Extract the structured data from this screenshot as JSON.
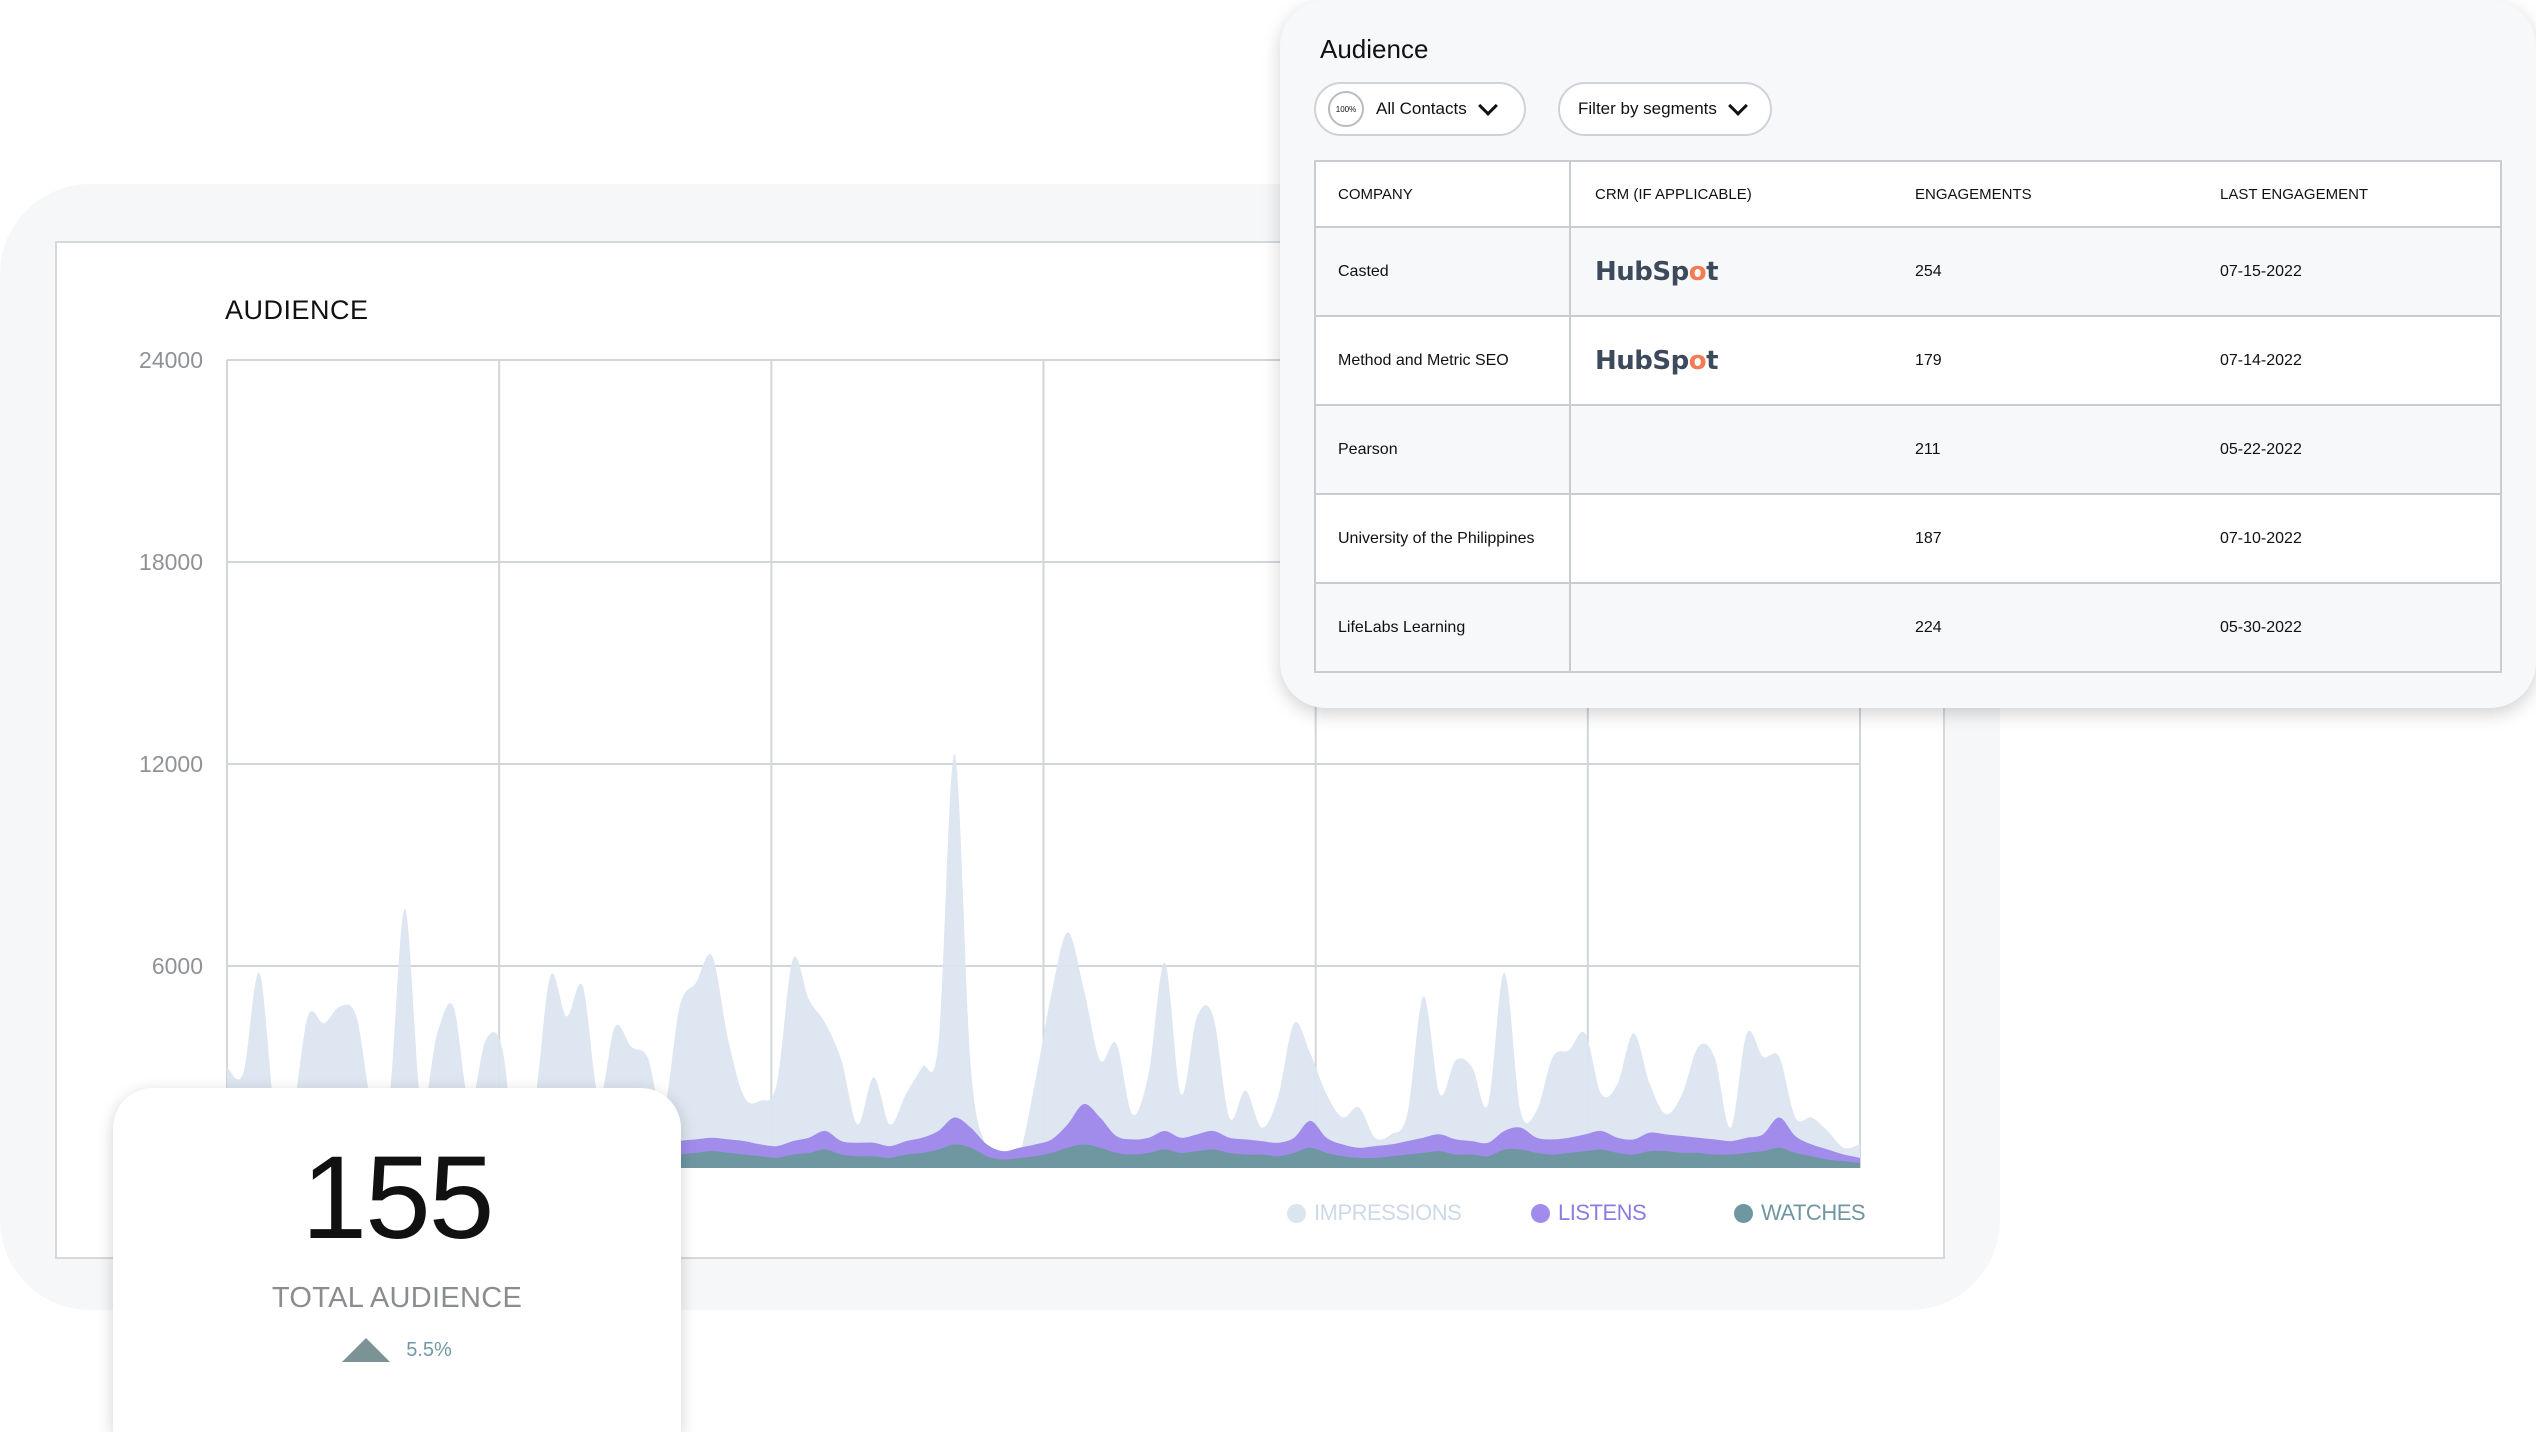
{
  "chart_card": {
    "title": "AUDIENCE",
    "legend": [
      {
        "label": "IMPRESSIONS",
        "color": "#dbe5f0",
        "text_color": "#cdd9e7"
      },
      {
        "label": "LISTENS",
        "color": "#a18ceb",
        "text_color": "#8d7be4"
      },
      {
        "label": "WATCHES",
        "color": "#6f97a2",
        "text_color": "#6f97a2"
      }
    ]
  },
  "chart_data": {
    "type": "area",
    "title": "AUDIENCE",
    "ylim": [
      0,
      24000
    ],
    "yticks": [
      "24000",
      "18000",
      "12000",
      "6000"
    ],
    "grid": true,
    "legend_position": "bottom-right",
    "series": [
      {
        "name": "IMPRESSIONS",
        "color": "#dbe5f0",
        "values": [
          3000,
          2800,
          5800,
          1500,
          1500,
          4500,
          4300,
          4800,
          4500,
          1800,
          1900,
          7700,
          1900,
          4000,
          4800,
          1900,
          3800,
          3600,
          100,
          1800,
          5700,
          4500,
          5400,
          2100,
          4200,
          3600,
          3300,
          1700,
          4800,
          5500,
          6300,
          3800,
          2100,
          2000,
          2500,
          6200,
          5000,
          4300,
          3200,
          1300,
          2700,
          1300,
          2200,
          3000,
          3700,
          12300,
          3000,
          600,
          100,
          400,
          2600,
          5200,
          7000,
          5300,
          3200,
          3700,
          1600,
          2800,
          6100,
          2200,
          4500,
          4500,
          1500,
          2300,
          1200,
          2100,
          4300,
          3400,
          2200,
          1500,
          1800,
          900,
          1000,
          1600,
          5100,
          2200,
          3200,
          3000,
          1900,
          5800,
          1700,
          1700,
          3300,
          3500,
          4000,
          2200,
          2500,
          4000,
          2500,
          1600,
          2200,
          3600,
          3300,
          1200,
          4000,
          3300,
          3300,
          1500,
          1500,
          1100,
          600,
          700
        ]
      },
      {
        "name": "LISTENS",
        "color": "#a18ceb",
        "values": [
          800,
          700,
          800,
          700,
          750,
          800,
          800,
          750,
          800,
          700,
          650,
          700,
          750,
          800,
          800,
          700,
          750,
          800,
          600,
          650,
          800,
          850,
          850,
          800,
          700,
          750,
          700,
          650,
          800,
          850,
          900,
          850,
          800,
          700,
          650,
          800,
          900,
          1100,
          800,
          750,
          750,
          650,
          800,
          900,
          1100,
          1500,
          1200,
          700,
          500,
          600,
          700,
          850,
          1300,
          1900,
          1500,
          950,
          850,
          900,
          1100,
          900,
          1000,
          1100,
          900,
          850,
          800,
          750,
          900,
          1400,
          900,
          700,
          600,
          650,
          700,
          800,
          900,
          1000,
          850,
          800,
          750,
          1100,
          1200,
          900,
          850,
          900,
          1000,
          1100,
          900,
          850,
          1050,
          1000,
          950,
          900,
          850,
          800,
          900,
          1000,
          1500,
          950,
          700,
          550,
          400,
          300
        ]
      },
      {
        "name": "WATCHES",
        "color": "#6f97a2",
        "values": [
          400,
          350,
          350,
          300,
          350,
          400,
          400,
          350,
          400,
          350,
          300,
          350,
          400,
          400,
          400,
          350,
          350,
          400,
          300,
          300,
          400,
          450,
          450,
          400,
          350,
          350,
          300,
          300,
          400,
          450,
          500,
          450,
          400,
          350,
          300,
          400,
          450,
          550,
          400,
          350,
          350,
          300,
          400,
          450,
          550,
          700,
          600,
          350,
          250,
          300,
          350,
          450,
          600,
          700,
          600,
          450,
          400,
          450,
          550,
          450,
          500,
          550,
          450,
          400,
          400,
          350,
          450,
          600,
          450,
          350,
          300,
          300,
          350,
          400,
          450,
          500,
          400,
          400,
          350,
          550,
          550,
          450,
          400,
          450,
          500,
          550,
          450,
          400,
          500,
          500,
          450,
          450,
          400,
          400,
          450,
          500,
          600,
          450,
          350,
          250,
          200,
          150
        ]
      }
    ]
  },
  "table_card": {
    "title": "Audience",
    "contacts_badge": "100%",
    "contacts_label": "All Contacts",
    "segments_label": "Filter by segments",
    "columns": [
      "COMPANY",
      "CRM (IF APPLICABLE)",
      "ENGAGEMENTS",
      "LAST ENGAGEMENT"
    ],
    "rows": [
      {
        "company": "Casted",
        "crm": "HubSpot",
        "engagements": "254",
        "last": "07-15-2022"
      },
      {
        "company": "Method and Metric SEO",
        "crm": "HubSpot",
        "engagements": "179",
        "last": "07-14-2022"
      },
      {
        "company": "Pearson",
        "crm": "",
        "engagements": "211",
        "last": "05-22-2022"
      },
      {
        "company": "University of the Philippines",
        "crm": "",
        "engagements": "187",
        "last": "07-10-2022"
      },
      {
        "company": "LifeLabs Learning",
        "crm": "",
        "engagements": "224",
        "last": "05-30-2022"
      }
    ]
  },
  "total_card": {
    "value": "155",
    "label": "TOTAL AUDIENCE",
    "change": "5.5%",
    "change_color": "#6f9aa5"
  }
}
